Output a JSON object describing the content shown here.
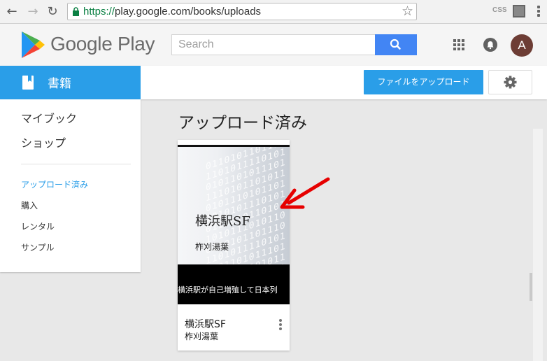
{
  "browser": {
    "url_scheme": "https://",
    "url_rest": "play.google.com/books/uploads",
    "extension_label": "CSS"
  },
  "header": {
    "logo_text": "Google Play",
    "search_placeholder": "Search",
    "avatar_letter": "A"
  },
  "subheader": {
    "category_label": "書籍",
    "upload_button_label": "ファイルをアップロード"
  },
  "sidebar": {
    "main_items": [
      {
        "label": "マイブック"
      },
      {
        "label": "ショップ"
      }
    ],
    "sub_items": [
      {
        "label": "アップロード済み",
        "active": true
      },
      {
        "label": "購入"
      },
      {
        "label": "レンタル"
      },
      {
        "label": "サンプル"
      }
    ]
  },
  "main": {
    "title": "アップロード済み",
    "books": [
      {
        "cover_title": "横浜駅SF",
        "cover_author": "柞刈湯葉",
        "cover_blurb": "横浜駅が自己増殖して日本列",
        "title": "横浜駅SF",
        "author": "柞刈湯葉"
      }
    ]
  },
  "colors": {
    "accent_blue": "#2a9ee8",
    "search_blue": "#4285f4",
    "arrow_red": "#e60000"
  }
}
